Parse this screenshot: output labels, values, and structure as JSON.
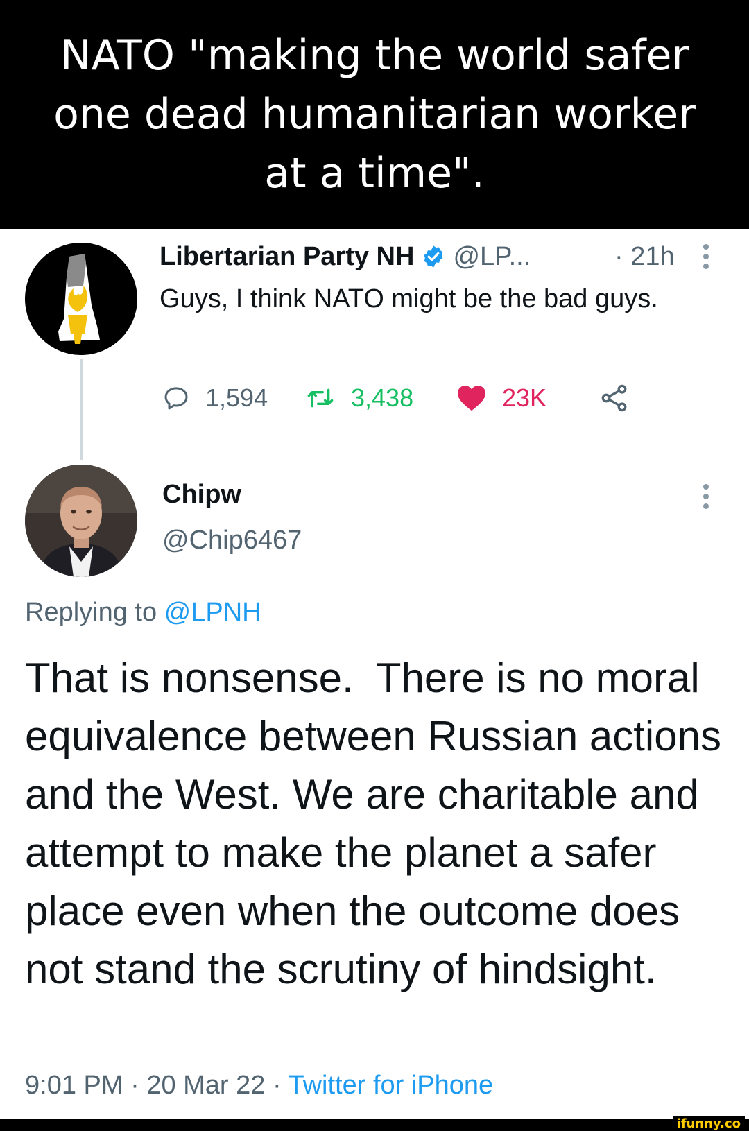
{
  "caption": "NATO \"making the world safer\none dead humanitarian worker\nat a time\".",
  "tweet1": {
    "name": "Libertarian Party NH",
    "handle": "@LP...",
    "time": "· 21h",
    "text": "Guys, I think NATO might be the bad guys.",
    "replies": "1,594",
    "retweets": "3,438",
    "likes": "23K"
  },
  "tweet2": {
    "name": "Chipw",
    "handle": "@Chip6467",
    "replying_prefix": "Replying to ",
    "replying_to": "@LPNH",
    "text": "That is nonsense.  There is no moral equivalence between Russian actions and the West. We are charitable and attempt to make the planet a safer place even when the outcome does not stand the scrutiny of hindsight.",
    "time": "9:01 PM",
    "date": "20 Mar 22",
    "source": "Twitter for iPhone"
  },
  "watermark": "ifunny.co",
  "icons": {
    "verified": "verified-badge-icon",
    "reply": "speech-bubble-icon",
    "retweet": "retweet-arrows-icon",
    "like": "heart-icon",
    "share": "share-nodes-icon",
    "more": "vertical-dots-icon"
  },
  "colors": {
    "caption_bg": "#000000",
    "link": "#1d9bf0",
    "retweet": "#17bf63",
    "like": "#e0245e",
    "muted": "#536471"
  }
}
